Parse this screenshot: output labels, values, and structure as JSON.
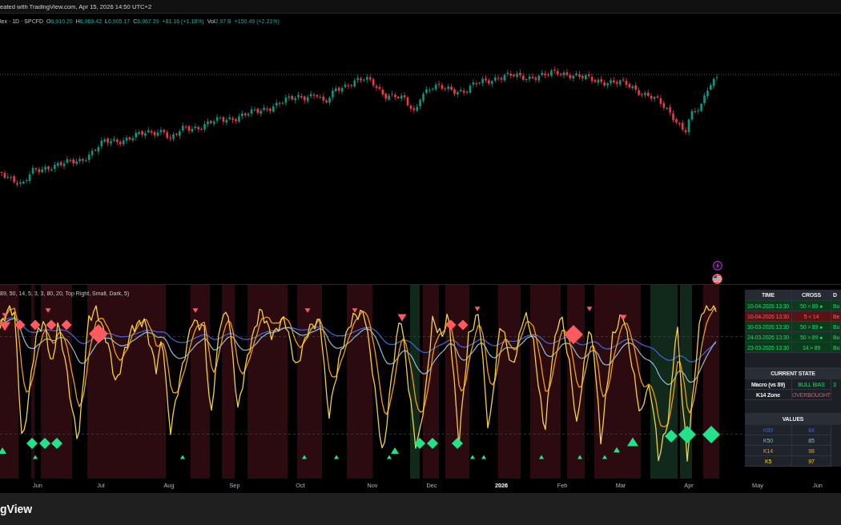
{
  "caption": {
    "text": "eated with TradingView.com, Apr 15, 2026 14:50 UTC+2"
  },
  "legend": {
    "symbol": "lex · 1D · SPCFD",
    "ohlc": [
      {
        "label": "O",
        "value": "6,910.20"
      },
      {
        "label": "H",
        "value": "6,969.42"
      },
      {
        "label": "L",
        "value": "6,905.17"
      },
      {
        "label": "C",
        "value": "6,967.39"
      }
    ],
    "change": "+81.16 (+1.18%)",
    "volume": {
      "label": "Vol",
      "value": "2.97 B",
      "change": "+150.49 (+2.21%)"
    }
  },
  "indicator": {
    "arguments": "89, 50, 14, 5, 3, 3, 80, 20, Top Right, Small, Dark, 5)"
  },
  "signals_table": {
    "columns": [
      "TIME",
      "CROSS",
      "D"
    ],
    "rows": [
      {
        "kind": "bull",
        "time": "10-04-2026 13:30",
        "cross": "50 > 89 ●",
        "column_3": "Bu"
      },
      {
        "kind": "bear",
        "time": "10-04-2026 13:30",
        "cross": "5 < 14",
        "column_3": "Be"
      },
      {
        "kind": "bull",
        "time": "30-03-2026 13:30",
        "cross": "50 > 89 ●",
        "column_3": "Bu"
      },
      {
        "kind": "bull",
        "time": "24-03-2026 13:30",
        "cross": "50 > 89 ●",
        "column_3": "Bu"
      },
      {
        "kind": "bull",
        "time": "23-03-2026 13:30",
        "cross": "14 > 89",
        "column_3": "Bu"
      }
    ]
  },
  "current_state": {
    "title": "CURRENT STATE",
    "rows": [
      {
        "kind": "bull",
        "label": "Macro (vs 89)",
        "value": "BULL BIAS",
        "column_3": "3"
      },
      {
        "kind": "bear",
        "label": "K14 Zone",
        "value": "OVERBOUGHT"
      }
    ]
  },
  "values": {
    "title": "VALUES",
    "rows": [
      {
        "label": "K89",
        "value": "84",
        "color": "#3f63d4"
      },
      {
        "label": "K50",
        "value": "85",
        "color": "#8ab4c4"
      },
      {
        "label": "K14",
        "value": "98",
        "color": "#f39c12"
      },
      {
        "label": "K5",
        "value": "97",
        "color": "#f5d142"
      }
    ]
  },
  "time_axis": {
    "ticks": [
      {
        "label": "Jun",
        "kind": "month"
      },
      {
        "label": "Jul",
        "kind": "month"
      },
      {
        "label": "Aug",
        "kind": "month"
      },
      {
        "label": "Sep",
        "kind": "month"
      },
      {
        "label": "Oct",
        "kind": "month"
      },
      {
        "label": "Nov",
        "kind": "month"
      },
      {
        "label": "Dec",
        "kind": "month"
      },
      {
        "label": "2026",
        "kind": "year"
      },
      {
        "label": "Feb",
        "kind": "month"
      },
      {
        "label": "Mar",
        "kind": "month"
      },
      {
        "label": "Apr",
        "kind": "month"
      },
      {
        "label": "May",
        "kind": "month"
      },
      {
        "label": "Jun",
        "kind": "month"
      }
    ]
  },
  "footer": {
    "brand": "gView"
  }
}
